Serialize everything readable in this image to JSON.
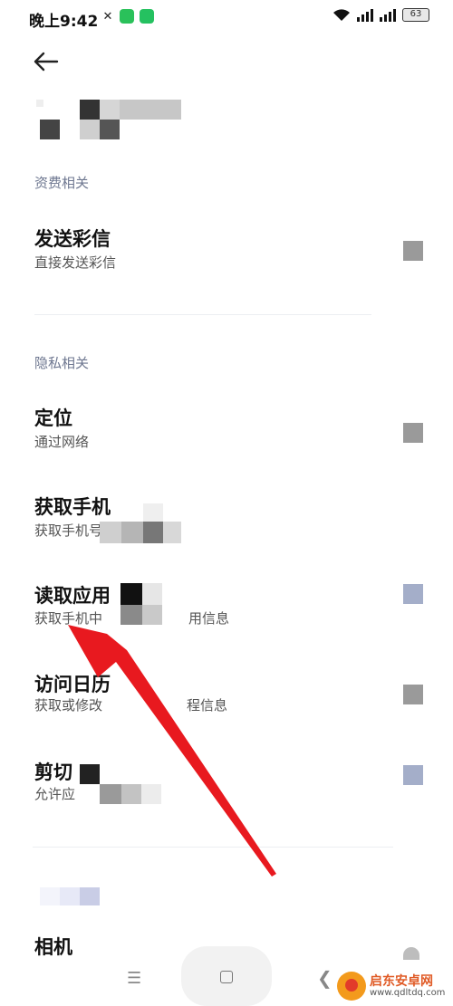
{
  "status_bar": {
    "time": "晚上9:42",
    "battery": "63"
  },
  "sections": [
    {
      "title": "资费相关"
    },
    {
      "title": "隐私相关"
    }
  ],
  "rows": [
    {
      "title": "发送彩信",
      "subtitle": "直接发送彩信"
    },
    {
      "title": "定位",
      "subtitle": "通过网络"
    },
    {
      "title": "获取手机",
      "subtitle": "获取手机号"
    },
    {
      "title": "读取应用",
      "subtitle": "获取手机中",
      "subtitle_tail": "用信息"
    },
    {
      "title": "访问日历",
      "subtitle": "获取或修改",
      "subtitle_tail": "程信息"
    },
    {
      "title": "剪切",
      "subtitle": "允许应"
    },
    {
      "title": "相机"
    }
  ],
  "colors": {
    "accent_section": "#6e7790",
    "toggle_gray": "#9a9a9a",
    "toggle_blue": "#a4aec9",
    "arrow_red": "#e8191f"
  },
  "icons": {
    "back": "back-arrow-icon",
    "nav_menu": "menu-icon",
    "nav_home": "home-icon",
    "nav_back": "chevron-left-icon"
  },
  "watermark": {
    "name": "启东安卓网",
    "url": "www.qdltdq.com"
  }
}
